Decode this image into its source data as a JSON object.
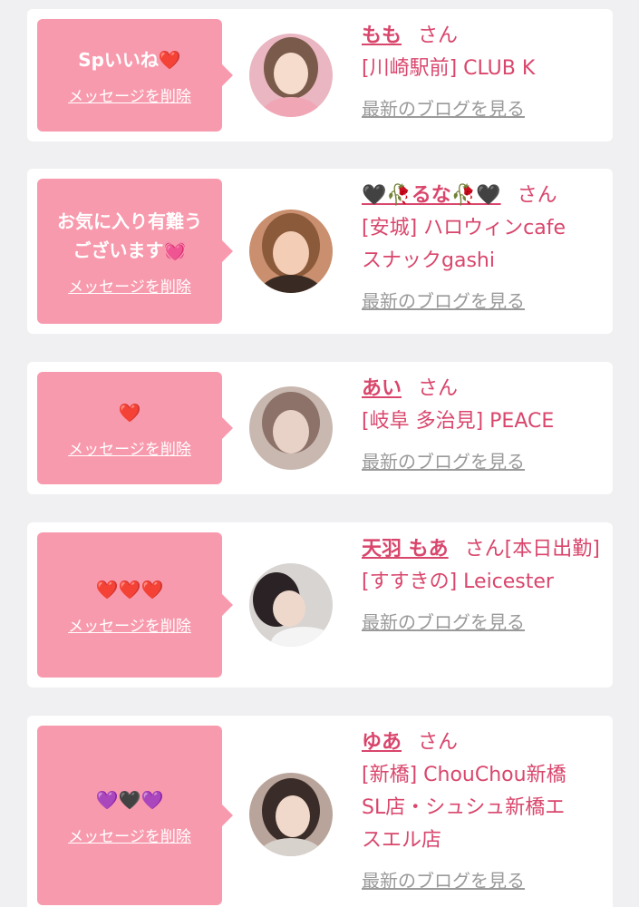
{
  "messages": [
    {
      "text": "Spいいね❤️",
      "delete_label": "メッセージを削除",
      "name": "もも",
      "honorific": "さん",
      "shop": "[川崎駅前] CLUB K",
      "blog_label": "最新のブログを見る",
      "avatar_bg": "#e9b6c2"
    },
    {
      "text": "お気に入り有難う\nございます💓",
      "delete_label": "メッセージを削除",
      "name": "🖤🥀るな🥀🖤",
      "honorific": "さん",
      "shop": "[安城] ハロウィンcafe\nスナックgashi",
      "blog_label": "最新のブログを見る",
      "avatar_bg": "#c98f6e"
    },
    {
      "text": "❤️",
      "delete_label": "メッセージを削除",
      "name": "あい",
      "honorific": "さん",
      "shop": "[岐阜 多治見] PEACE",
      "blog_label": "最新のブログを見る",
      "avatar_bg": "#c9b8b0"
    },
    {
      "text": "❤️❤️❤️",
      "delete_label": "メッセージを削除",
      "name": "天羽 もあ",
      "honorific": "さん[本日出勤]",
      "shop": "[すすきの] Leicester",
      "blog_label": "最新のブログを見る",
      "avatar_bg": "#d8d4d2"
    },
    {
      "text": "💜🖤💜",
      "delete_label": "メッセージを削除",
      "name": "ゆあ",
      "honorific": "さん",
      "shop": "[新橋] ChouChou新橋\nSL店・シュシュ新橋エ\nスエル店",
      "blog_label": "最新のブログを見る",
      "avatar_bg": "#b8a49a"
    }
  ]
}
